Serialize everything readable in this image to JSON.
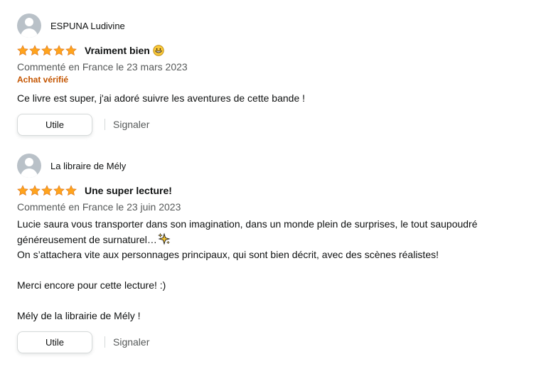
{
  "reviews": [
    {
      "author": "ESPUNA Ludivine",
      "rating": 5,
      "title": "Vraiment bien",
      "title_emoji": "grinning-face-icon",
      "date": "Commenté en France le 23 mars 2023",
      "verified": "Achat vérifié",
      "body": [
        "Ce livre est super, j'ai adoré suivre les aventures de cette bande !"
      ],
      "helpful_label": "Utile",
      "report_label": "Signaler"
    },
    {
      "author": "La libraire de Mély",
      "rating": 5,
      "title": "Une super lecture!",
      "date": "Commenté en France le 23 juin 2023",
      "body_lines": [
        "Lucie saura vous transporter dans son imagination, dans un monde plein de surprises, le tout saupoudré",
        "généreusement de surnaturel…",
        "On s’attachera vite aux personnages principaux, qui sont bien décrit, avec des scènes réalistes!",
        "",
        "Merci encore pour cette lecture! :)",
        "",
        "Mély de la librairie de Mély !"
      ],
      "body_emoji": "sparkles-icon",
      "helpful_label": "Utile",
      "report_label": "Signaler"
    }
  ],
  "colors": {
    "star": "#ffa41c",
    "verified": "#c45500",
    "secondary_text": "#565959",
    "avatar": "#b9c1c8"
  }
}
